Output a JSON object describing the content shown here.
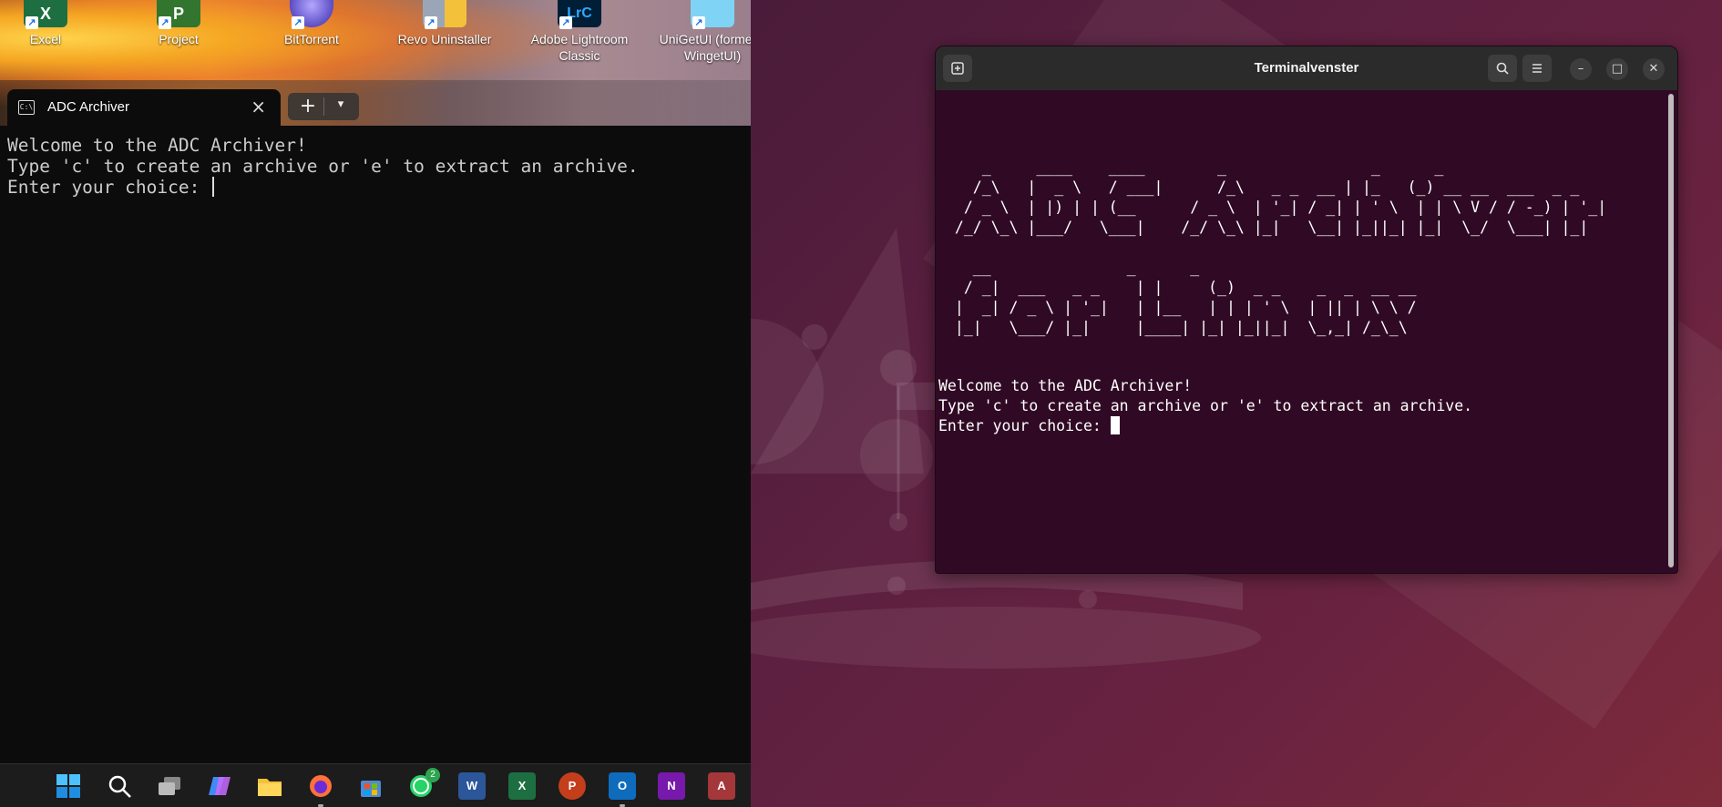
{
  "windows": {
    "desktop_icons": [
      {
        "label": "Excel",
        "color": "#1d6f42",
        "glyph": "X"
      },
      {
        "label": "Project",
        "color": "#31752f",
        "glyph": "P"
      },
      {
        "label": "BitTorrent",
        "color": "#5b4cc4",
        "glyph": ""
      },
      {
        "label": "Revo Uninstaller",
        "color": "#6a7fa0",
        "glyph": ""
      },
      {
        "label": "Adobe Lightroom Classic",
        "color": "#001e36",
        "glyph": "LrC"
      },
      {
        "label": "UniGetUI (formerly WingetUI)",
        "color": "#1e9bd7",
        "glyph": ""
      }
    ],
    "terminal": {
      "tab_title": "ADC Archiver",
      "tab_icon": "terminal-icon",
      "lines": [
        "Welcome to the ADC Archiver!",
        "Type 'c' to create an archive or 'e' to extract an archive.",
        "Enter your choice: "
      ],
      "new_tab_label": "+",
      "dropdown_label": "⌄"
    },
    "taskbar": {
      "items": [
        {
          "name": "start-icon",
          "glyph": "",
          "color": "#0078d4"
        },
        {
          "name": "search-icon",
          "glyph": "",
          "color": ""
        },
        {
          "name": "task-view-icon",
          "glyph": "",
          "color": ""
        },
        {
          "name": "copilot-icon",
          "glyph": "",
          "color": "#7a5af8"
        },
        {
          "name": "file-explorer-icon",
          "glyph": "",
          "color": "#f3c13a"
        },
        {
          "name": "firefox-icon",
          "glyph": "",
          "color": "#ff7139"
        },
        {
          "name": "microsoft-store-icon",
          "glyph": "",
          "color": "#4b8bd6"
        },
        {
          "name": "whatsapp-icon",
          "glyph": "",
          "color": "#25d366"
        },
        {
          "name": "word-icon",
          "glyph": "W",
          "color": "#2b579a"
        },
        {
          "name": "excel-icon",
          "glyph": "X",
          "color": "#1d6f42"
        },
        {
          "name": "powerpoint-icon",
          "glyph": "P",
          "color": "#c43e1c"
        },
        {
          "name": "outlook-icon",
          "glyph": "O",
          "color": "#0f6cbd"
        },
        {
          "name": "onenote-icon",
          "glyph": "N",
          "color": "#7719aa"
        },
        {
          "name": "access-icon",
          "glyph": "A",
          "color": "#a4373a"
        }
      ],
      "whatsapp_badge": "2"
    }
  },
  "ubuntu": {
    "terminal": {
      "title": "Terminalvenster",
      "ascii_art": "    _     ____    ____        _                _      _                   \n   /_\\   |  _ \\   / ___|      /_\\   _ _  __ | |_   (_) __ __  ___  _ _ \n  / _ \\  | |) | | (__      / _ \\  | '_| / _| | ' \\  | | \\ V / / -_) | '_|\n /_/ \\_\\ |___/   \\___|    /_/ \\_\\ |_|   \\__| |_||_| |_|  \\_/  \\___| |_|  \n\n   __               _      _                       \n  / _|  ___   _ _    | |     (_)  _ _    _  _  __ __ \n |  _| / _ \\ | '_|   | |__   | | | ' \\  | || | \\ \\ / \n |_|   \\___/ |_|     |____| |_| |_||_|  \\_,_| /_\\_\\ ",
      "lines": [
        "Welcome to the ADC Archiver!",
        "Type 'c' to create an archive or 'e' to extract an archive.",
        "Enter your choice: "
      ]
    }
  },
  "colors": {
    "win_terminal_bg": "#0c0c0c",
    "ubuntu_terminal_bg": "#300a24",
    "ubuntu_header_bg": "#2b2b2b"
  }
}
